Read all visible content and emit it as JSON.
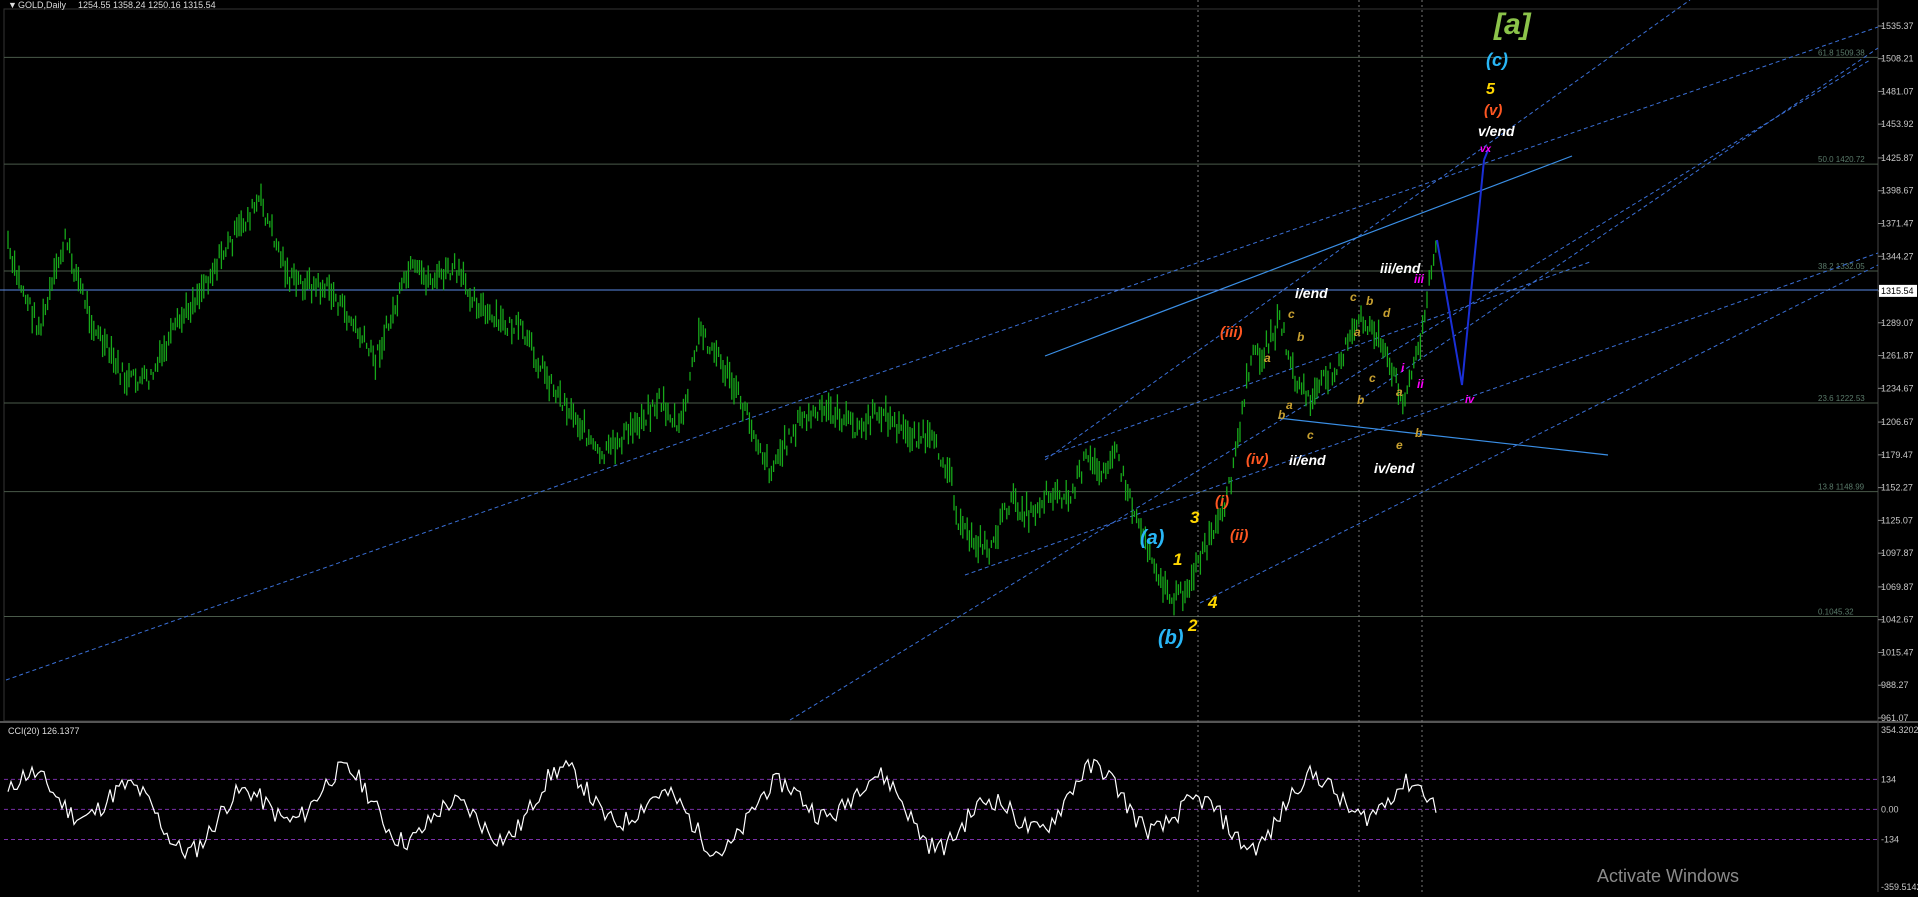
{
  "window": {
    "title_symbol": "GOLD,Daily",
    "ohlc": "1254.55 1358.24 1250.16 1315.54",
    "menu_icon": "triangle-down-icon"
  },
  "colors": {
    "background": "#000000",
    "candles": "#17a81a",
    "trendlines": "#3a6fd6",
    "cci_line": "#ffffff",
    "cci_levels": "#7a2fa8",
    "fib_lines": "#4a5a4a",
    "price_axis_text": "#c8c8c8"
  },
  "price_axis": {
    "labels": [
      "1535.37",
      "1508.21",
      "1481.07",
      "1453.92",
      "1425.87",
      "1398.67",
      "1371.47",
      "1344.27",
      "1315.54",
      "1289.07",
      "1261.87",
      "1234.67",
      "1206.67",
      "1179.47",
      "1152.27",
      "1125.07",
      "1097.87",
      "1069.87",
      "1042.67",
      "1015.47",
      "988.27",
      "961.07"
    ],
    "current_price": "1315.54",
    "range": [
      961.07,
      1535.37
    ]
  },
  "fib_levels": [
    {
      "label": "61.8 1509.38",
      "price": 1509.38
    },
    {
      "label": "50.0 1420.72",
      "price": 1420.72
    },
    {
      "label": "38.2 1332.05",
      "price": 1332.05
    },
    {
      "label": "23.6 1222.53",
      "price": 1222.53
    },
    {
      "label": "13.8 1148.99",
      "price": 1148.99
    },
    {
      "label": "0.1045.32",
      "price": 1045.32
    }
  ],
  "cci": {
    "title": "CCI(20) 126.1377",
    "labels": [
      "354.3202",
      "134",
      "0.00",
      "-134",
      "-359.5142"
    ],
    "levels": [
      134,
      0,
      -134
    ],
    "range": [
      -359.5142,
      354.3202
    ]
  },
  "wave_labels": [
    {
      "text": "[a]",
      "color": "#8bc34a"
    },
    {
      "text": "(c)",
      "color": "#29b6f6"
    },
    {
      "text": "5",
      "color": "#ffd600"
    },
    {
      "text": "(v)",
      "color": "#ff5722"
    },
    {
      "text": "v/end",
      "color": "#ffffff"
    },
    {
      "text": "vx",
      "color": "#ff00ff"
    },
    {
      "text": "iii/end",
      "color": "#ffffff"
    },
    {
      "text": "i/end",
      "color": "#ffffff"
    },
    {
      "text": "(iii)",
      "color": "#ff5722"
    },
    {
      "text": "ii/end",
      "color": "#ffffff"
    },
    {
      "text": "(iv)",
      "color": "#ff5722"
    },
    {
      "text": "iv/end",
      "color": "#ffffff"
    },
    {
      "text": "(i)",
      "color": "#ff5722"
    },
    {
      "text": "(ii)",
      "color": "#ff5722"
    },
    {
      "text": "(a)",
      "color": "#29b6f6"
    },
    {
      "text": "(b)",
      "color": "#29b6f6"
    },
    {
      "text": "1",
      "color": "#ffd600"
    },
    {
      "text": "2",
      "color": "#ffd600"
    },
    {
      "text": "3",
      "color": "#ffd600"
    },
    {
      "text": "4",
      "color": "#ffd600"
    },
    {
      "text": "iii",
      "color": "#ff00ff"
    },
    {
      "text": "ii",
      "color": "#ff00ff"
    },
    {
      "text": "i",
      "color": "#ff00ff"
    },
    {
      "text": "iv",
      "color": "#ff00ff"
    },
    {
      "text": "c",
      "color": "#c8a030"
    },
    {
      "text": "b",
      "color": "#c8a030"
    },
    {
      "text": "a",
      "color": "#c8a030"
    },
    {
      "text": "d",
      "color": "#c8a030"
    },
    {
      "text": "e",
      "color": "#c8a030"
    },
    {
      "text": "c",
      "color": "#c8a030"
    },
    {
      "text": "b",
      "color": "#c8a030"
    },
    {
      "text": "a",
      "color": "#c8a030"
    },
    {
      "text": "c",
      "color": "#c8a030"
    },
    {
      "text": "a",
      "color": "#c8a030"
    },
    {
      "text": "b",
      "color": "#c8a030"
    },
    {
      "text": "b",
      "color": "#c8a030"
    },
    {
      "text": "a",
      "color": "#c8a030"
    },
    {
      "text": "b",
      "color": "#c8a030"
    },
    {
      "text": "c",
      "color": "#c8a030"
    }
  ],
  "watermark": "Activate Windows"
}
